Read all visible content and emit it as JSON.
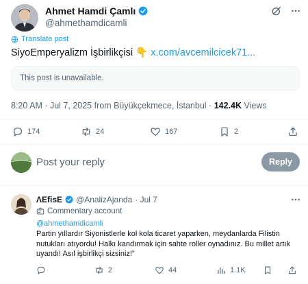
{
  "post": {
    "author_name": "Ahmet Hamdi Çamlı",
    "author_handle": "@ahmethamdicamli",
    "translate_label": "Translate post",
    "text": "SiyoEmperyalizm İşbirlikçisi",
    "emoji": "👇",
    "link_text": "x.com/avcemilcicek71...",
    "unavailable_text": "This post is unavailable.",
    "timestamp": "8:20 AM · Jul 7, 2025 from Büyükçekmece, İstanbul ·",
    "views_count": "142.4K",
    "views_label": "Views",
    "stats": {
      "replies": "174",
      "reposts": "24",
      "likes": "167",
      "bookmarks": "2"
    }
  },
  "reply_box": {
    "placeholder": "Post your reply",
    "button_label": "Reply"
  },
  "reply": {
    "author_name": "ɅEfisE",
    "author_handle": "@AnalizAjanda",
    "date": "· Jul 7",
    "account_type": "Commentary account",
    "mention": "@ahmethamdicamli",
    "text": "Partin yıllardır Siyonistlerle kol kola ticaret yaparken, meydanlarda Filistin nutukları atıyordu! Halkı kandırmak için sahte roller oynadınız. Bu millet artık uyandı! Asıl işbirlikçi sizsiniz!”",
    "stats": {
      "reposts": "2",
      "likes": "44",
      "views": "1.1K"
    }
  },
  "colors": {
    "accent": "#1d9bf0",
    "text": "#0f1419",
    "secondary": "#536471",
    "border": "#eff3f4",
    "reply_button": "#8b98a5"
  }
}
